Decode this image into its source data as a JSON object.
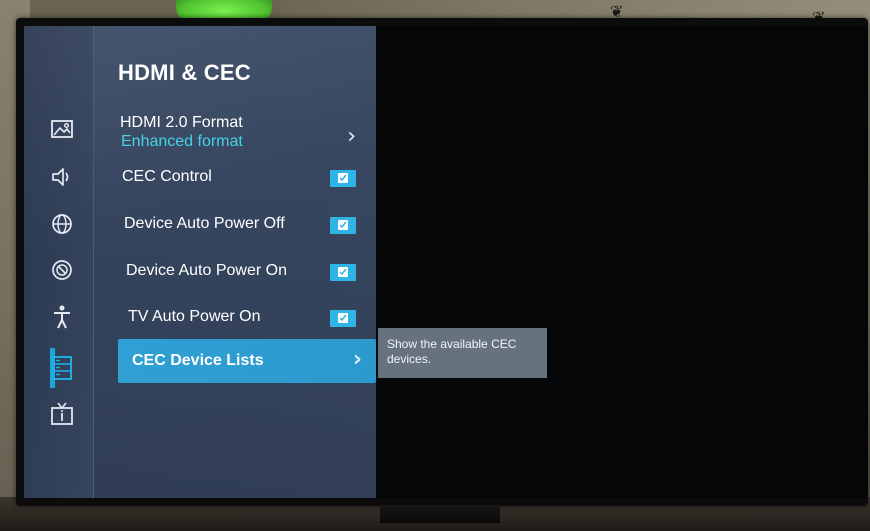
{
  "panel": {
    "title": "HDMI & CEC"
  },
  "rail_icons": [
    {
      "name": "picture-icon"
    },
    {
      "name": "sound-icon"
    },
    {
      "name": "network-icon"
    },
    {
      "name": "timer-icon"
    },
    {
      "name": "accessibility-icon"
    },
    {
      "name": "system-icon",
      "selected": true
    },
    {
      "name": "tv-info-icon"
    }
  ],
  "menu": {
    "hdmi_format": {
      "label": "HDMI 2.0 Format",
      "value": "Enhanced format"
    },
    "cec_control": {
      "label": "CEC Control",
      "checked": true
    },
    "device_auto_power_off": {
      "label": "Device Auto Power Off",
      "checked": true
    },
    "device_auto_power_on": {
      "label": "Device Auto Power On",
      "checked": true
    },
    "tv_auto_power_on": {
      "label": "TV Auto Power On",
      "checked": true
    },
    "cec_device_lists": {
      "label": "CEC Device Lists",
      "selected": true
    }
  },
  "tooltip": {
    "text": "Show the available CEC devices."
  },
  "colors": {
    "accent": "#2e9fd4",
    "checkbox": "#2eb4e6",
    "value_text": "#42d2e6",
    "panel": "#3a4963",
    "tooltip": "#67727f"
  }
}
